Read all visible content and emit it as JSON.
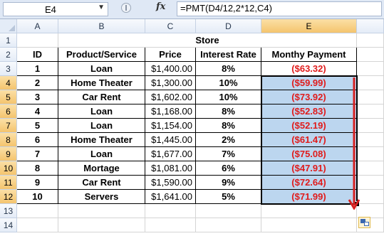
{
  "formula_bar": {
    "name_box": "E4",
    "fx_label": "fx",
    "formula": "=PMT(D4/12,2*12,C4)"
  },
  "columns": [
    "A",
    "B",
    "C",
    "D",
    "E"
  ],
  "rows": [
    "1",
    "2",
    "3",
    "4",
    "5",
    "6",
    "7",
    "8",
    "9",
    "10",
    "11",
    "12",
    "13",
    "14"
  ],
  "sheet": {
    "title": "Store",
    "headers": [
      "ID",
      "Product/Service",
      "Price",
      "Interest Rate",
      "Monthy Payment"
    ],
    "data": [
      [
        "1",
        "Loan",
        "$1,400.00",
        "8%",
        "($63.32)"
      ],
      [
        "2",
        "Home Theater",
        "$1,300.00",
        "10%",
        "($59.99)"
      ],
      [
        "3",
        "Car Rent",
        "$1,602.00",
        "10%",
        "($73.92)"
      ],
      [
        "4",
        "Loan",
        "$1,168.00",
        "8%",
        "($52.83)"
      ],
      [
        "5",
        "Loan",
        "$1,154.00",
        "8%",
        "($52.19)"
      ],
      [
        "6",
        "Home Theater",
        "$1,445.00",
        "2%",
        "($61.47)"
      ],
      [
        "7",
        "Loan",
        "$1,677.00",
        "7%",
        "($75.08)"
      ],
      [
        "8",
        "Mortage",
        "$1,081.00",
        "6%",
        "($47.91)"
      ],
      [
        "9",
        "Car Rent",
        "$1,590.00",
        "9%",
        "($72.64)"
      ],
      [
        "10",
        "Servers",
        "$1,641.00",
        "5%",
        "($71.99)"
      ]
    ]
  },
  "selection": {
    "active_cell": "E4",
    "range": "E4:E12"
  },
  "colors": {
    "selection_fill": "#bcd6ef",
    "negative": "#e01b1b",
    "arrow": "#d62020",
    "header_selected": "#f4c46e"
  }
}
